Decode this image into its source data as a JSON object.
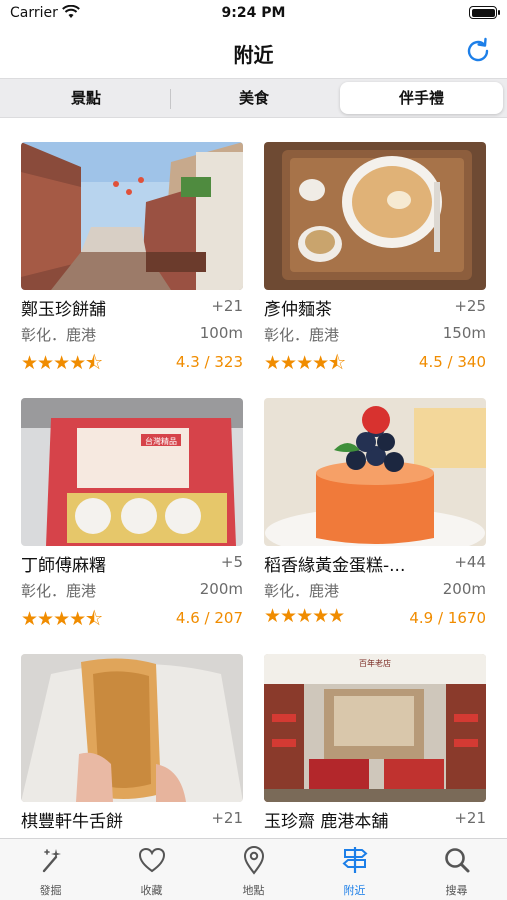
{
  "status_bar": {
    "carrier": "Carrier",
    "time": "9:24 PM"
  },
  "nav": {
    "title": "附近"
  },
  "segments": [
    {
      "label": "景點",
      "selected": false
    },
    {
      "label": "美食",
      "selected": false
    },
    {
      "label": "伴手禮",
      "selected": true
    }
  ],
  "items": [
    {
      "name": "鄭玉珍餅舖",
      "plus": "+21",
      "location": "彰化．鹿港",
      "distance": "100m",
      "rating": "4.3 / 323",
      "stars": "★★★★⯪"
    },
    {
      "name": "彥仲麵茶",
      "plus": "+25",
      "location": "彰化．鹿港",
      "distance": "150m",
      "rating": "4.5 / 340",
      "stars": "★★★★⯪"
    },
    {
      "name": "丁師傅麻糬",
      "plus": "+5",
      "location": "彰化．鹿港",
      "distance": "200m",
      "rating": "4.6 / 207",
      "stars": "★★★★⯪"
    },
    {
      "name": "稻香緣黃金蛋糕-...",
      "plus": "+44",
      "location": "彰化．鹿港",
      "distance": "200m",
      "rating": "4.9 / 1670",
      "stars": "★★★★★"
    },
    {
      "name": "棋豐軒牛舌餅",
      "plus": "+21"
    },
    {
      "name": "玉珍齋 鹿港本舖",
      "plus": "+21"
    }
  ],
  "image_texts": {
    "box_sign": "台灣精品",
    "shop_sign": "百年老店"
  },
  "tabs": [
    {
      "label": "發掘",
      "icon": "magic-wand-icon"
    },
    {
      "label": "收藏",
      "icon": "heart-icon"
    },
    {
      "label": "地點",
      "icon": "map-pin-icon"
    },
    {
      "label": "附近",
      "icon": "signpost-icon"
    },
    {
      "label": "搜尋",
      "icon": "search-icon"
    }
  ],
  "colors": {
    "accent": "#1d7fe8",
    "rating": "#f08c00",
    "secondary_text": "#6b6b6b"
  }
}
